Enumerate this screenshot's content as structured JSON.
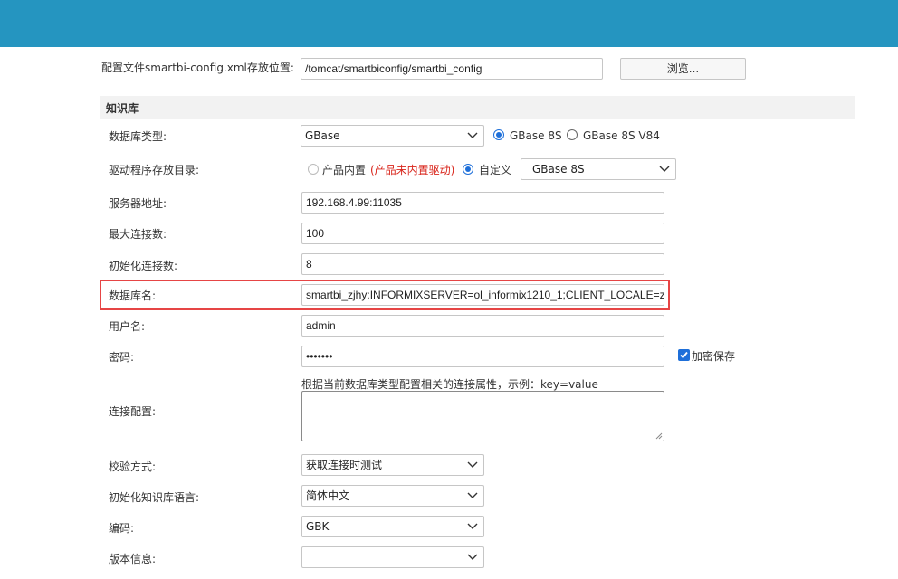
{
  "header": {
    "color": "#2595c0"
  },
  "config": {
    "label": "配置文件smartbi-config.xml存放位置:",
    "path": "/tomcat/smartbiconfig/smartbi_config",
    "browse_label": "浏览..."
  },
  "section": {
    "title": "知识库"
  },
  "db_type": {
    "label": "数据库类型:",
    "selected": "GBase",
    "options": [
      {
        "label": "GBase 8S",
        "checked": true
      },
      {
        "label": "GBase 8S V84",
        "checked": false
      }
    ]
  },
  "driver": {
    "label": "驱动程序存放目录:",
    "builtin_label": "产品内置",
    "builtin_note": "(产品未内置驱动)",
    "custom_label": "自定义",
    "custom_selected": "GBase 8S",
    "note_color": "#d9261c"
  },
  "server": {
    "label": "服务器地址:",
    "value": "192.168.4.99:11035"
  },
  "max_conn": {
    "label": "最大连接数:",
    "value": "100"
  },
  "init_conn": {
    "label": "初始化连接数:",
    "value": "8"
  },
  "db_name": {
    "label": "数据库名:",
    "value": "smartbi_zjhy:INFORMIXSERVER=ol_informix1210_1;CLIENT_LOCALE=z"
  },
  "username": {
    "label": "用户名:",
    "value": "admin"
  },
  "password": {
    "label": "密码:",
    "value": "•••••••",
    "encrypt_label": "加密保存"
  },
  "conn_config": {
    "label": "连接配置:",
    "hint": "根据当前数据库类型配置相关的连接属性，示例：key=value"
  },
  "validate": {
    "label": "校验方式:",
    "selected": "获取连接时测试"
  },
  "init_lang": {
    "label": "初始化知识库语言:",
    "selected": "简体中文"
  },
  "encoding": {
    "label": "编码:",
    "selected": "GBK"
  },
  "version": {
    "label": "版本信息:",
    "selected": ""
  },
  "colors": {
    "accent": "#1e6fd9",
    "highlight": "#e64545"
  }
}
